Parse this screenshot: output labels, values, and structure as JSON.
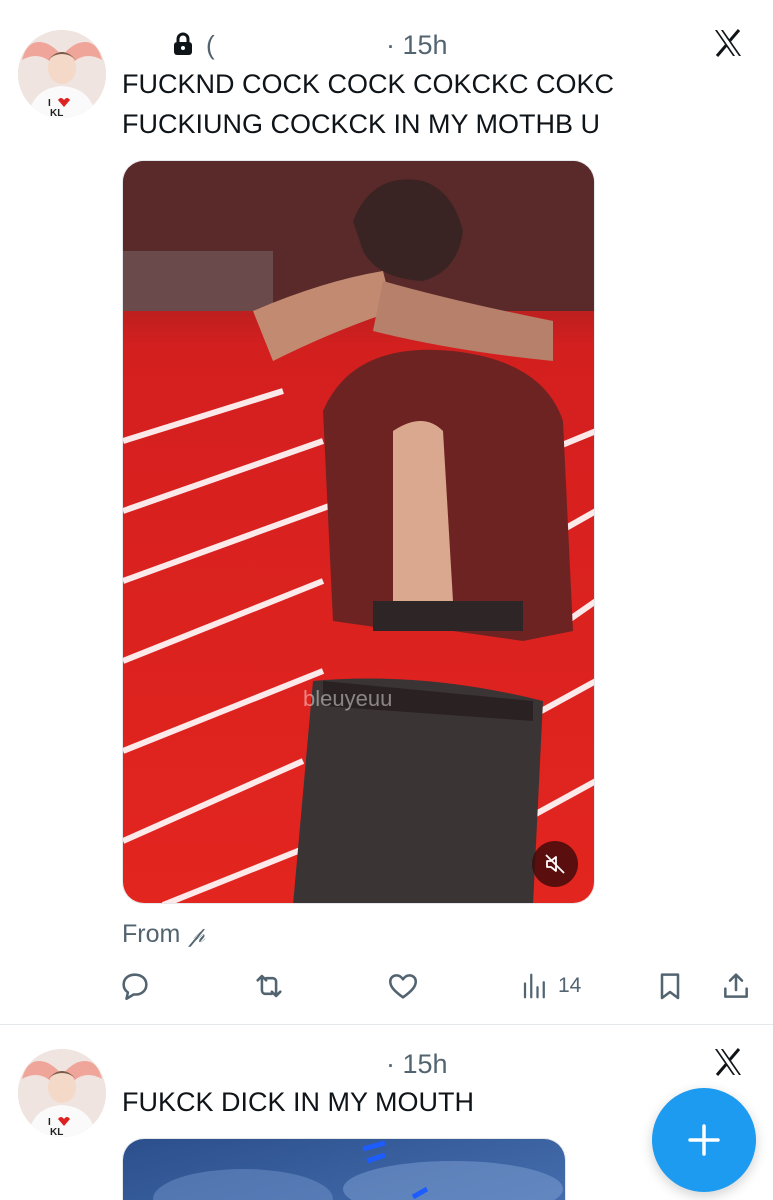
{
  "tweets": [
    {
      "time": "· 15h",
      "text_lines": [
        "FUCKND COCK COCK COKCKC COKC",
        "FUCKIUNG COCKCK IN MY MOTHB U"
      ],
      "media": {
        "watermark": "bleuyeuu",
        "sound": "muted"
      },
      "from_label": "From",
      "from_glyph": "𝓅",
      "actions": {
        "views_count": "14"
      },
      "icons": {
        "lock": "lock-icon",
        "brand": "x-logo-icon",
        "mute": "speaker-muted-icon",
        "reply": "reply-icon",
        "retweet": "retweet-icon",
        "like": "heart-icon",
        "views": "views-icon",
        "bookmark": "bookmark-icon",
        "share": "share-icon"
      }
    },
    {
      "time": "· 15h",
      "text": "FUKCK DICK IN MY MOUTH",
      "icons": {
        "brand": "x-logo-icon"
      }
    }
  ],
  "fab": {
    "icon": "plus-icon",
    "label": "+"
  },
  "colors": {
    "accent": "#1d9bf0",
    "text": "#0f1419",
    "secondary": "#536471",
    "divider": "#e5e8eb"
  }
}
